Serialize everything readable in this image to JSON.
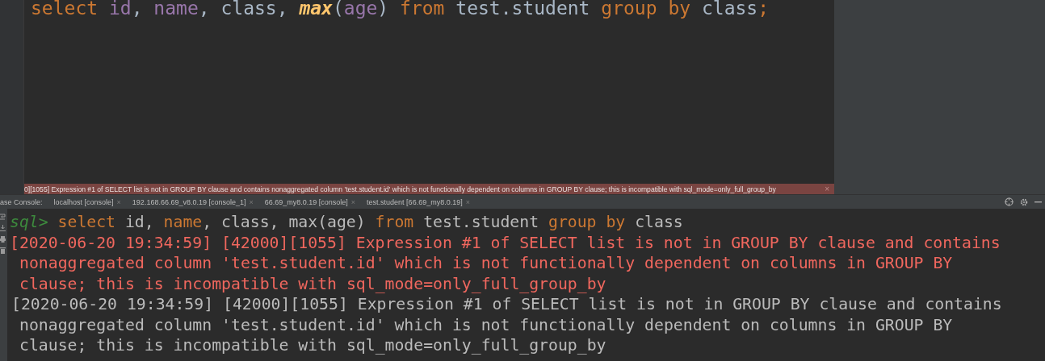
{
  "editor": {
    "code_line": [
      {
        "kind": "keyword",
        "text": "select"
      },
      {
        "kind": "field",
        "text": " id"
      },
      {
        "kind": "plain",
        "text": ", "
      },
      {
        "kind": "field",
        "text": "name"
      },
      {
        "kind": "plain",
        "text": ", "
      },
      {
        "kind": "plain",
        "text": "class"
      },
      {
        "kind": "plain",
        "text": ", "
      },
      {
        "kind": "function",
        "text": "max"
      },
      {
        "kind": "plain",
        "text": "("
      },
      {
        "kind": "field",
        "text": "age"
      },
      {
        "kind": "plain",
        "text": ") "
      },
      {
        "kind": "keyword",
        "text": "from"
      },
      {
        "kind": "plain",
        "text": " test.student "
      },
      {
        "kind": "keyword",
        "text": "group by"
      },
      {
        "kind": "plain",
        "text": " class"
      },
      {
        "kind": "keyword",
        "text": ";"
      }
    ]
  },
  "error_banner": {
    "text": "0][1055] Expression #1 of SELECT list is not in GROUP BY clause and contains nonaggregated column 'test.student.id' which is not functionally dependent on columns in GROUP BY clause; this is incompatible with sql_mode=only_full_group_by",
    "close": "×"
  },
  "console_tabs": {
    "label": "ase Console:",
    "tabs": [
      {
        "label": "localhost [console]",
        "close": "×"
      },
      {
        "label": "192.168.66.69_v8.0.19 [console_1]",
        "close": "×"
      },
      {
        "label": "66.69_my8.0.19 [console]",
        "close": "×"
      },
      {
        "label": "test.student [66.69_my8.0.19]",
        "close": "×"
      }
    ]
  },
  "console": {
    "prompt": "sql>",
    "command": [
      {
        "kind": "keyword",
        "text": "select"
      },
      {
        "kind": "plain",
        "text": " id, "
      },
      {
        "kind": "keyword",
        "text": "name"
      },
      {
        "kind": "plain",
        "text": ", class, max(age) "
      },
      {
        "kind": "keyword",
        "text": "from"
      },
      {
        "kind": "plain",
        "text": " test.student "
      },
      {
        "kind": "keyword",
        "text": "group by"
      },
      {
        "kind": "plain",
        "text": " class"
      }
    ],
    "messages": [
      {
        "kind": "error",
        "lines": [
          "[2020-06-20 19:34:59] [42000][1055] Expression #1 of SELECT list is not in GROUP BY clause and contains",
          "nonaggregated column 'test.student.id' which is not functionally dependent on columns in GROUP BY",
          "clause; this is incompatible with sql_mode=only_full_group_by"
        ]
      },
      {
        "kind": "info",
        "lines": [
          "[2020-06-20 19:34:59] [42000][1055] Expression #1 of SELECT list is not in GROUP BY clause and contains",
          "nonaggregated column 'test.student.id' which is not functionally dependent on columns in GROUP BY",
          "clause; this is incompatible with sql_mode=only_full_group_by"
        ]
      }
    ]
  }
}
